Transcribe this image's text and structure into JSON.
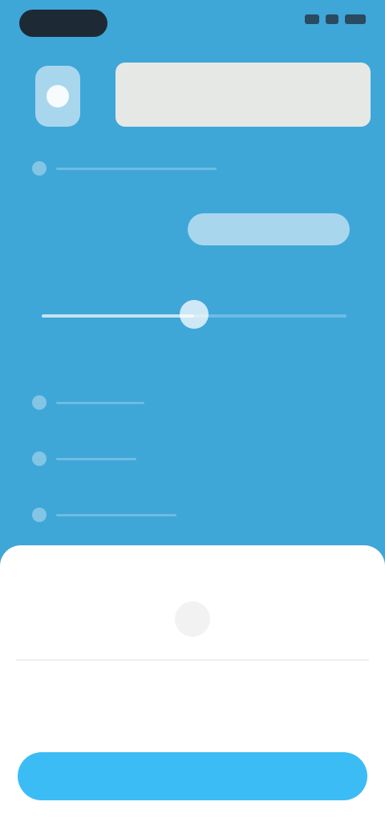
{
  "status_bar": {
    "time": ""
  },
  "header": {
    "card_text": ""
  },
  "rows": [
    {
      "label": "",
      "value": ""
    },
    {
      "label": "",
      "value": ""
    },
    {
      "label": "",
      "value": ""
    },
    {
      "label": "",
      "value": ""
    },
    {
      "label": "",
      "value": ""
    }
  ],
  "controls": {
    "pill_button_label": ""
  },
  "slider": {
    "fraction": 0.5
  },
  "sheet": {
    "center_label": "",
    "primary_button_label": ""
  },
  "colors": {
    "background": "#3fa6d8",
    "sheet": "#ffffff",
    "primary_button": "#3cbcf4"
  },
  "icons": {
    "app_icon": "app-icon",
    "row_icons": [
      "row-icon",
      "row-icon",
      "row-icon",
      "row-icon"
    ],
    "center_icon": "placeholder-icon"
  }
}
